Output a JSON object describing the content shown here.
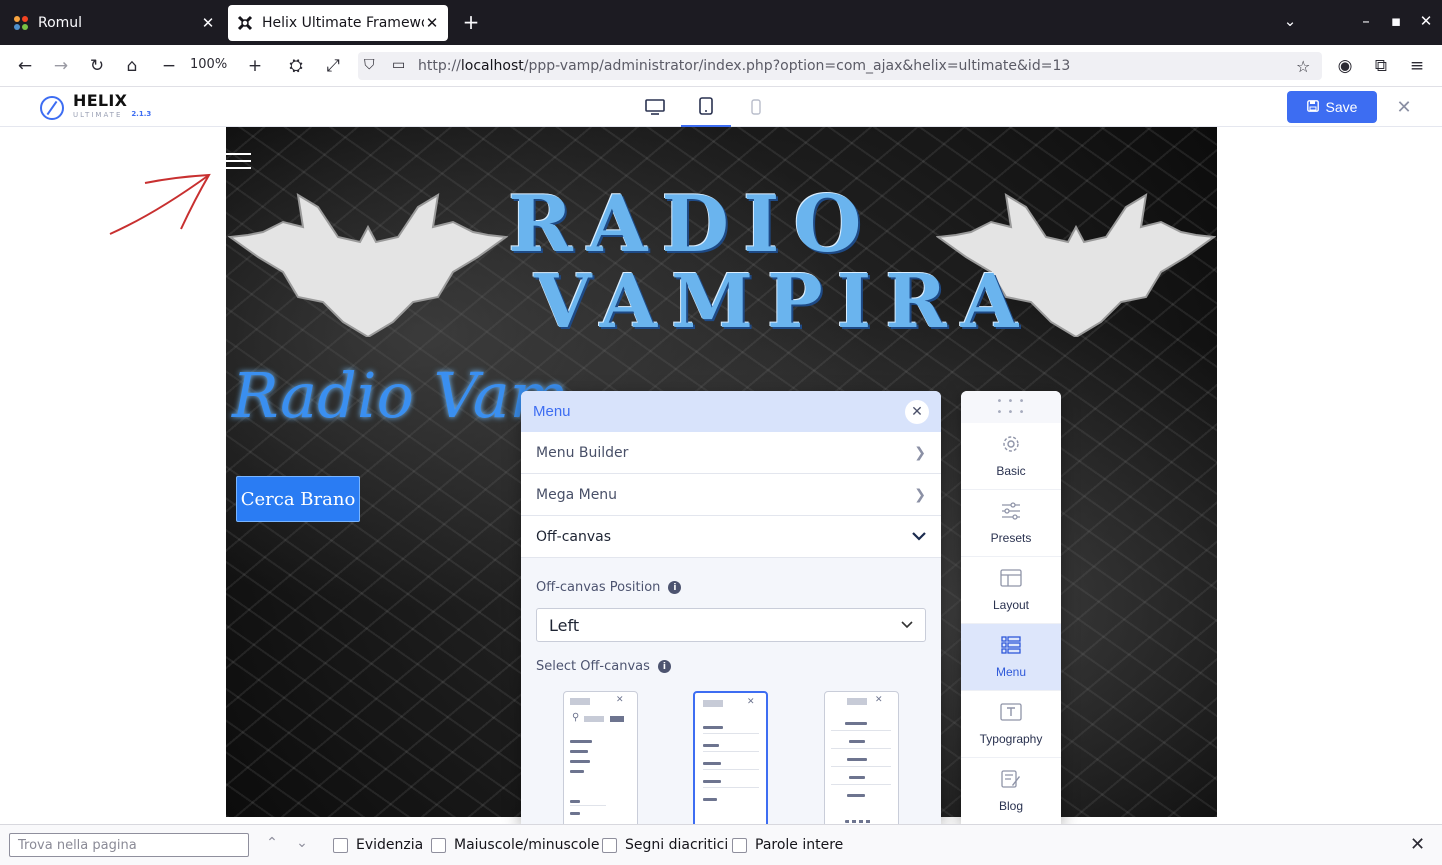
{
  "browser": {
    "tabs": [
      {
        "label": "Romul",
        "favicon": "joomla-icon",
        "active": false
      },
      {
        "label": "Helix Ultimate Framework",
        "favicon": "helix-icon",
        "active": true
      }
    ],
    "zoom": "100%",
    "url_prefix": "http://",
    "url_host": "localhost",
    "url_path": "/ppp-vamp/administrator/index.php?option=com_ajax&helix=ultimate&id=13"
  },
  "helix": {
    "brand": "HELIX",
    "brand_sub": "ULTIMATE",
    "version": "2.1.3",
    "save_label": "Save",
    "active_device": "tablet",
    "accent": "#3d6df2"
  },
  "site": {
    "title_line1": "RADIO",
    "title_line2": "VAMPIRA",
    "cursive_text": "Radio Vam",
    "search_button": "Cerca Brano"
  },
  "panel": {
    "title": "Menu",
    "sections": [
      {
        "label": "Menu Builder",
        "state": "collapsed"
      },
      {
        "label": "Mega Menu",
        "state": "collapsed"
      },
      {
        "label": "Off-canvas",
        "state": "expanded"
      }
    ],
    "position_label": "Off-canvas Position",
    "position_value": "Left",
    "select_label": "Select Off-canvas",
    "selected_style": 2
  },
  "sidebar": {
    "items": [
      {
        "label": "Basic",
        "icon": "gear-icon",
        "active": false
      },
      {
        "label": "Presets",
        "icon": "sliders-icon",
        "active": false
      },
      {
        "label": "Layout",
        "icon": "layout-icon",
        "active": false
      },
      {
        "label": "Menu",
        "icon": "menu-list-icon",
        "active": true
      },
      {
        "label": "Typography",
        "icon": "typography-icon",
        "active": false
      },
      {
        "label": "Blog",
        "icon": "blog-icon",
        "active": false
      }
    ]
  },
  "findbar": {
    "placeholder": "Trova nella pagina",
    "options": [
      "Evidenzia",
      "Maiuscole/minuscole",
      "Segni diacritici",
      "Parole intere"
    ]
  }
}
